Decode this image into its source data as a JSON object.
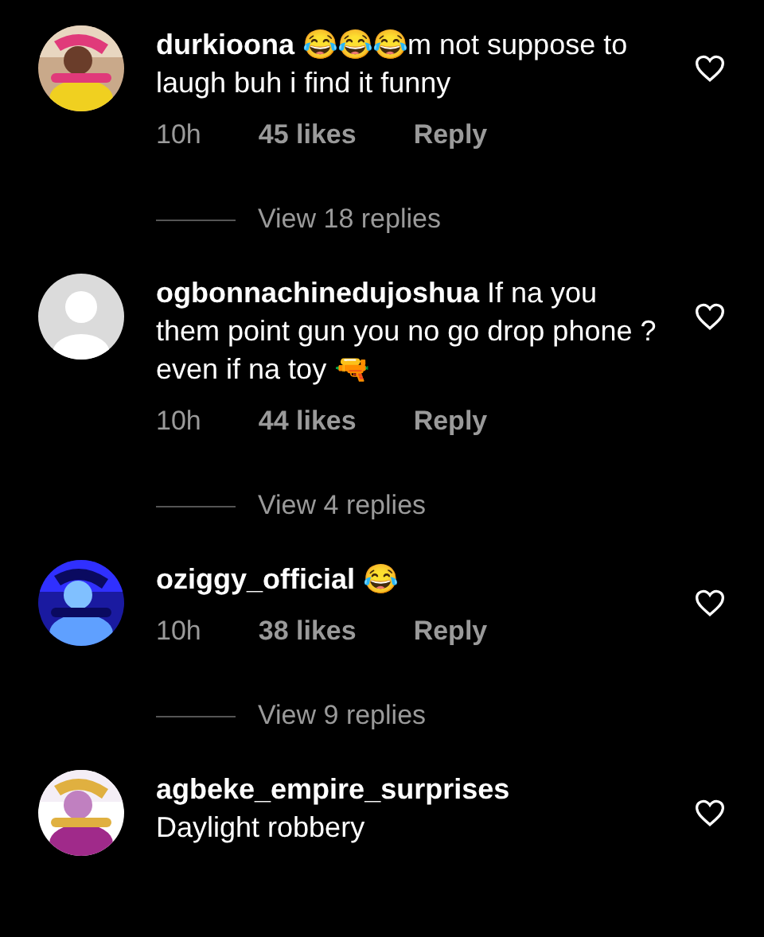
{
  "comments": [
    {
      "text": "**durkioona** 😂😂😂m not suppose to laugh buh i find it funny",
      "liked": false,
      "time": "10h",
      "likes": "45 likes",
      "reply": "Reply",
      "view_replies": "View 18 replies"
    },
    {
      "avatar": {
        "kind": "default"
      },
      "text": "**ogbonnachinedujoshua** If na you them point gun you no go drop phone ? even if na toy 🔫",
      "liked": false,
      "time": "10h",
      "likes": "44 likes",
      "reply": "Reply",
      "view_replies": "View 4 replies"
    },
    {
      "text": "**oziggy_official** 😂",
      "liked": false,
      "time": "10h",
      "likes": "38 likes",
      "reply": "Reply",
      "view_replies": "View 9 replies"
    },
    {
      "text": "**agbeke_empire_surprises**\nDaylight robbery",
      "liked": false
    }
  ]
}
